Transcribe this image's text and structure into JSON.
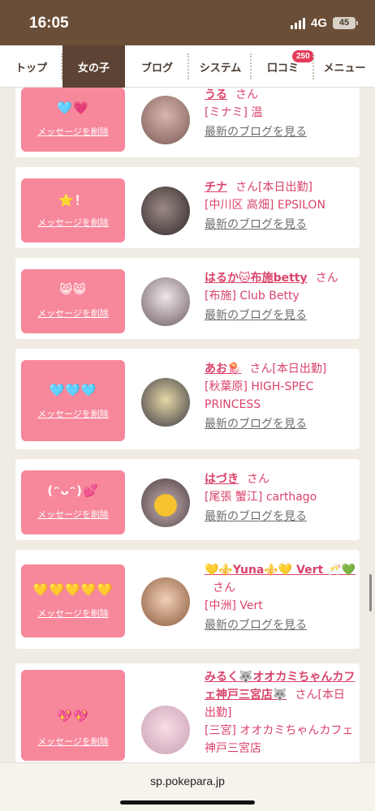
{
  "status_bar": {
    "time": "16:05",
    "network": "4G",
    "battery": "45"
  },
  "nav_tabs": [
    {
      "label": "トップ"
    },
    {
      "label": "女の子",
      "active": true
    },
    {
      "label": "ブログ"
    },
    {
      "label": "システム"
    },
    {
      "label": "口コミ",
      "badge": "250"
    },
    {
      "label": "メニュー"
    }
  ],
  "delete_label": "メッセージを削除",
  "blog_link_label": "最新のブログを見る",
  "girls": [
    {
      "emoji": "🩵💗",
      "name": "うる",
      "suffix": "さん",
      "location": "[ミナミ] 温"
    },
    {
      "emoji": "⭐️！",
      "name": "チナ",
      "suffix": "さん[本日出勤]",
      "location": "[中川区 高畑] EPSILON"
    },
    {
      "emoji": "😸😸",
      "name": "はるか🐱布施betty",
      "suffix": "さん",
      "location": "[布施] Club Betty"
    },
    {
      "emoji": "🩵🩵🩵",
      "name": "あお🪼",
      "suffix": "さん[本日出勤]",
      "location": "[秋葉原] HIGH-SPEC PRINCESS"
    },
    {
      "emoji": "(ᵔᴗᵔ)💕",
      "name": "はづき",
      "suffix": "さん",
      "location": "[尾張 蟹江] carthago"
    },
    {
      "emoji": "💛💛💛💛💛",
      "name": "💛⚜️Yuna⚜️💛 Vert 🥂💚",
      "suffix": "さん",
      "location": "[中洲] Vert"
    },
    {
      "emoji": "💖💖",
      "name": "みるく🐺オオカミちゃんカフェ神戸三宮店🐺",
      "suffix": "さん[本日出勤]",
      "location": "[三宮] オオカミちゃんカフェ神戸三宮店"
    }
  ],
  "browser": {
    "url": "sp.pokepara.jp"
  },
  "colors": {
    "status_bar": "#6b4e37",
    "active_tab": "#5c4333",
    "accent_pink": "#d9436a",
    "message_box": "#f7879b",
    "badge": "#e53b5a",
    "background": "#f1ece3"
  }
}
